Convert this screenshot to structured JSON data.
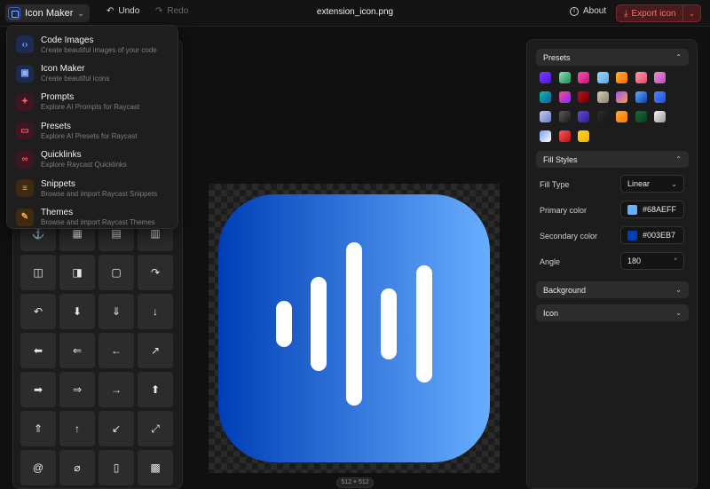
{
  "topbar": {
    "app_name": "Icon Maker",
    "undo": "Undo",
    "redo": "Redo",
    "filename": "extension_icon.png",
    "about": "About",
    "export": "Export icon"
  },
  "menu": [
    {
      "title": "Code Images",
      "subtitle": "Create beautiful images of your code",
      "icon": "code-icon",
      "glyph": "‹›",
      "bg": "#1d2b52",
      "fg": "#7aa7ff"
    },
    {
      "title": "Icon Maker",
      "subtitle": "Create beautiful icons",
      "icon": "icon-maker-icon",
      "glyph": "▣",
      "bg": "#1c2a4f",
      "fg": "#8fb2ff"
    },
    {
      "title": "Prompts",
      "subtitle": "Explore AI Prompts for Raycast",
      "icon": "sparkle-icon",
      "glyph": "✦",
      "bg": "#3d1620",
      "fg": "#ff5a6a"
    },
    {
      "title": "Presets",
      "subtitle": "Explore AI Presets for Raycast",
      "icon": "chat-icon",
      "glyph": "▭",
      "bg": "#3d1620",
      "fg": "#ff5a6a"
    },
    {
      "title": "Quicklinks",
      "subtitle": "Explore Raycast Quicklinks",
      "icon": "link-icon",
      "glyph": "∞",
      "bg": "#3d1620",
      "fg": "#ff5a6a"
    },
    {
      "title": "Snippets",
      "subtitle": "Browse and import Raycast Snippets",
      "icon": "snippet-icon",
      "glyph": "≡",
      "bg": "#3d2a10",
      "fg": "#ffa23a"
    },
    {
      "title": "Themes",
      "subtitle": "Browse and import Raycast Themes",
      "icon": "brush-icon",
      "glyph": "✎",
      "bg": "#3d2a10",
      "fg": "#ffa23a"
    }
  ],
  "icon_grid": [
    {
      "name": "anchor-icon",
      "glyph": "⚓"
    },
    {
      "name": "calendar-icon",
      "glyph": "▦"
    },
    {
      "name": "calendar-grid-icon",
      "glyph": "▤"
    },
    {
      "name": "calendar-list-icon",
      "glyph": "▥"
    },
    {
      "name": "sidebar-left-icon",
      "glyph": "◫"
    },
    {
      "name": "sidebar-right-icon",
      "glyph": "◨"
    },
    {
      "name": "app-window-icon",
      "glyph": "▢"
    },
    {
      "name": "redo-icon",
      "glyph": "↷"
    },
    {
      "name": "undo-icon",
      "glyph": "↶"
    },
    {
      "name": "arrow-down-circle-filled-icon",
      "glyph": "⬇"
    },
    {
      "name": "arrow-down-circle-icon",
      "glyph": "⇓"
    },
    {
      "name": "arrow-down-icon",
      "glyph": "↓"
    },
    {
      "name": "arrow-left-circle-filled-icon",
      "glyph": "⬅"
    },
    {
      "name": "arrow-left-circle-icon",
      "glyph": "⇐"
    },
    {
      "name": "arrow-left-icon",
      "glyph": "←"
    },
    {
      "name": "arrow-up-right-icon",
      "glyph": "↗"
    },
    {
      "name": "arrow-right-circle-filled-icon",
      "glyph": "➡"
    },
    {
      "name": "arrow-right-circle-icon",
      "glyph": "⇒"
    },
    {
      "name": "arrow-right-icon",
      "glyph": "→"
    },
    {
      "name": "arrow-up-circle-filled-icon",
      "glyph": "⬆"
    },
    {
      "name": "arrow-up-circle-icon",
      "glyph": "⇑"
    },
    {
      "name": "arrow-up-icon",
      "glyph": "↑"
    },
    {
      "name": "minimize-icon",
      "glyph": "↙"
    },
    {
      "name": "maximize-icon",
      "glyph": "⤢"
    },
    {
      "name": "at-icon",
      "glyph": "@"
    },
    {
      "name": "paperclip-icon",
      "glyph": "⌀"
    },
    {
      "name": "book-icon",
      "glyph": "▯"
    },
    {
      "name": "calculator-icon",
      "glyph": "▩"
    }
  ],
  "canvas": {
    "size_label": "512 × 512",
    "gradient_type": "Linear",
    "gradient_start": "#003EB7",
    "gradient_end": "#68AEFF",
    "icon_name": "waveform-icon",
    "bar_color": "#FFFFFF"
  },
  "presets": {
    "title": "Presets",
    "swatches": [
      "linear-gradient(135deg,#7b3bff,#4a17d6)",
      "linear-gradient(135deg,#8be3b0,#1e8a55)",
      "linear-gradient(135deg,#ff4fb3,#c3147c)",
      "linear-gradient(135deg,#9fd8ff,#57a6e8)",
      "linear-gradient(135deg,#ffb13b,#ff6a00)",
      "linear-gradient(135deg,#ff9aa8,#e14a66)",
      "linear-gradient(135deg,#f08bd0,#b64fc8)",
      "linear-gradient(135deg,#14b8a6,#0b5fa5)",
      "linear-gradient(135deg,#ff4b8b,#7a2cff)",
      "linear-gradient(135deg,#c70e1c,#5e0008)",
      "linear-gradient(135deg,#d9ccb2,#8d8270)",
      "linear-gradient(135deg,#a355ff,#f2a03b)",
      "linear-gradient(135deg,#68AEFF,#003EB7)",
      "linear-gradient(135deg,#4f86ff,#1f4dd8)",
      "linear-gradient(135deg,#c4cdf0,#6c7bc8)",
      "linear-gradient(135deg,#5a5a5a,#1a1a1a)",
      "linear-gradient(135deg,#6b46e0,#2b1c8a)",
      "linear-gradient(135deg,#2e2e2e,#151515)",
      "linear-gradient(135deg,#ffa53b,#ff7a00)",
      "linear-gradient(135deg,#1b6b3a,#0b3a1d)",
      "linear-gradient(135deg,#f2f2f2,#9a9a9a)",
      "linear-gradient(135deg,#7aa2ff,#ffffff)",
      "linear-gradient(135deg,#ff5a5a,#b30f0f)",
      "linear-gradient(135deg,#ffd42a,#f0b400)"
    ]
  },
  "fill_styles": {
    "title": "Fill Styles",
    "fill_type_label": "Fill Type",
    "fill_type_value": "Linear",
    "primary_label": "Primary color",
    "primary_value": "#68AEFF",
    "secondary_label": "Secondary color",
    "secondary_value": "#003EB7",
    "angle_label": "Angle",
    "angle_value": "180",
    "angle_unit": "°"
  },
  "background": {
    "title": "Background"
  },
  "icon_section": {
    "title": "Icon"
  }
}
